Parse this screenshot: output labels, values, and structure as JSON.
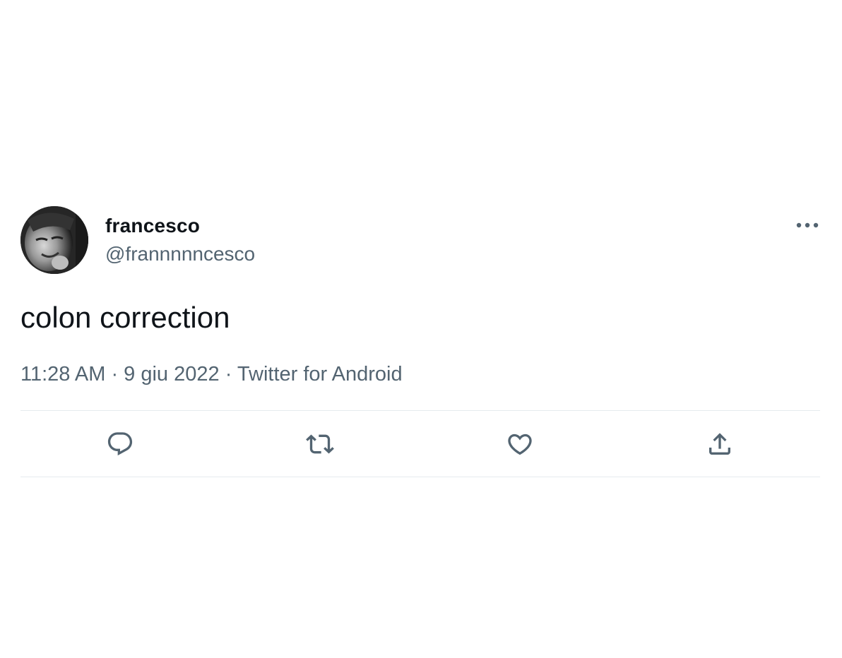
{
  "tweet": {
    "author": {
      "display_name": "francesco",
      "handle": "@frannnnncesco"
    },
    "text": "colon correction",
    "meta": {
      "time": "11:28 AM",
      "separator": "·",
      "date": "9 giu 2022",
      "source": "Twitter for Android"
    }
  },
  "icons": {
    "more": "more-horizontal-icon",
    "reply": "reply-icon",
    "retweet": "retweet-icon",
    "like": "heart-icon",
    "share": "share-icon"
  },
  "colors": {
    "text_primary": "#0f1419",
    "text_secondary": "#536471",
    "divider": "#e6ebee"
  }
}
